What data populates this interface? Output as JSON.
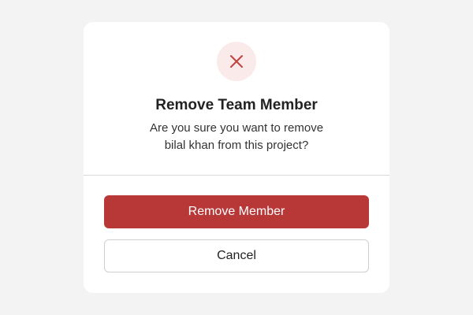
{
  "dialog": {
    "icon": "close-icon",
    "title": "Remove Team Member",
    "message_line1": "Are you sure you want to remove",
    "message_line2": "bilal khan from this project?",
    "confirm_label": "Remove Member",
    "cancel_label": "Cancel"
  },
  "colors": {
    "danger": "#b83838",
    "danger_tint": "#fbeaea",
    "background": "#f3f3f3"
  }
}
